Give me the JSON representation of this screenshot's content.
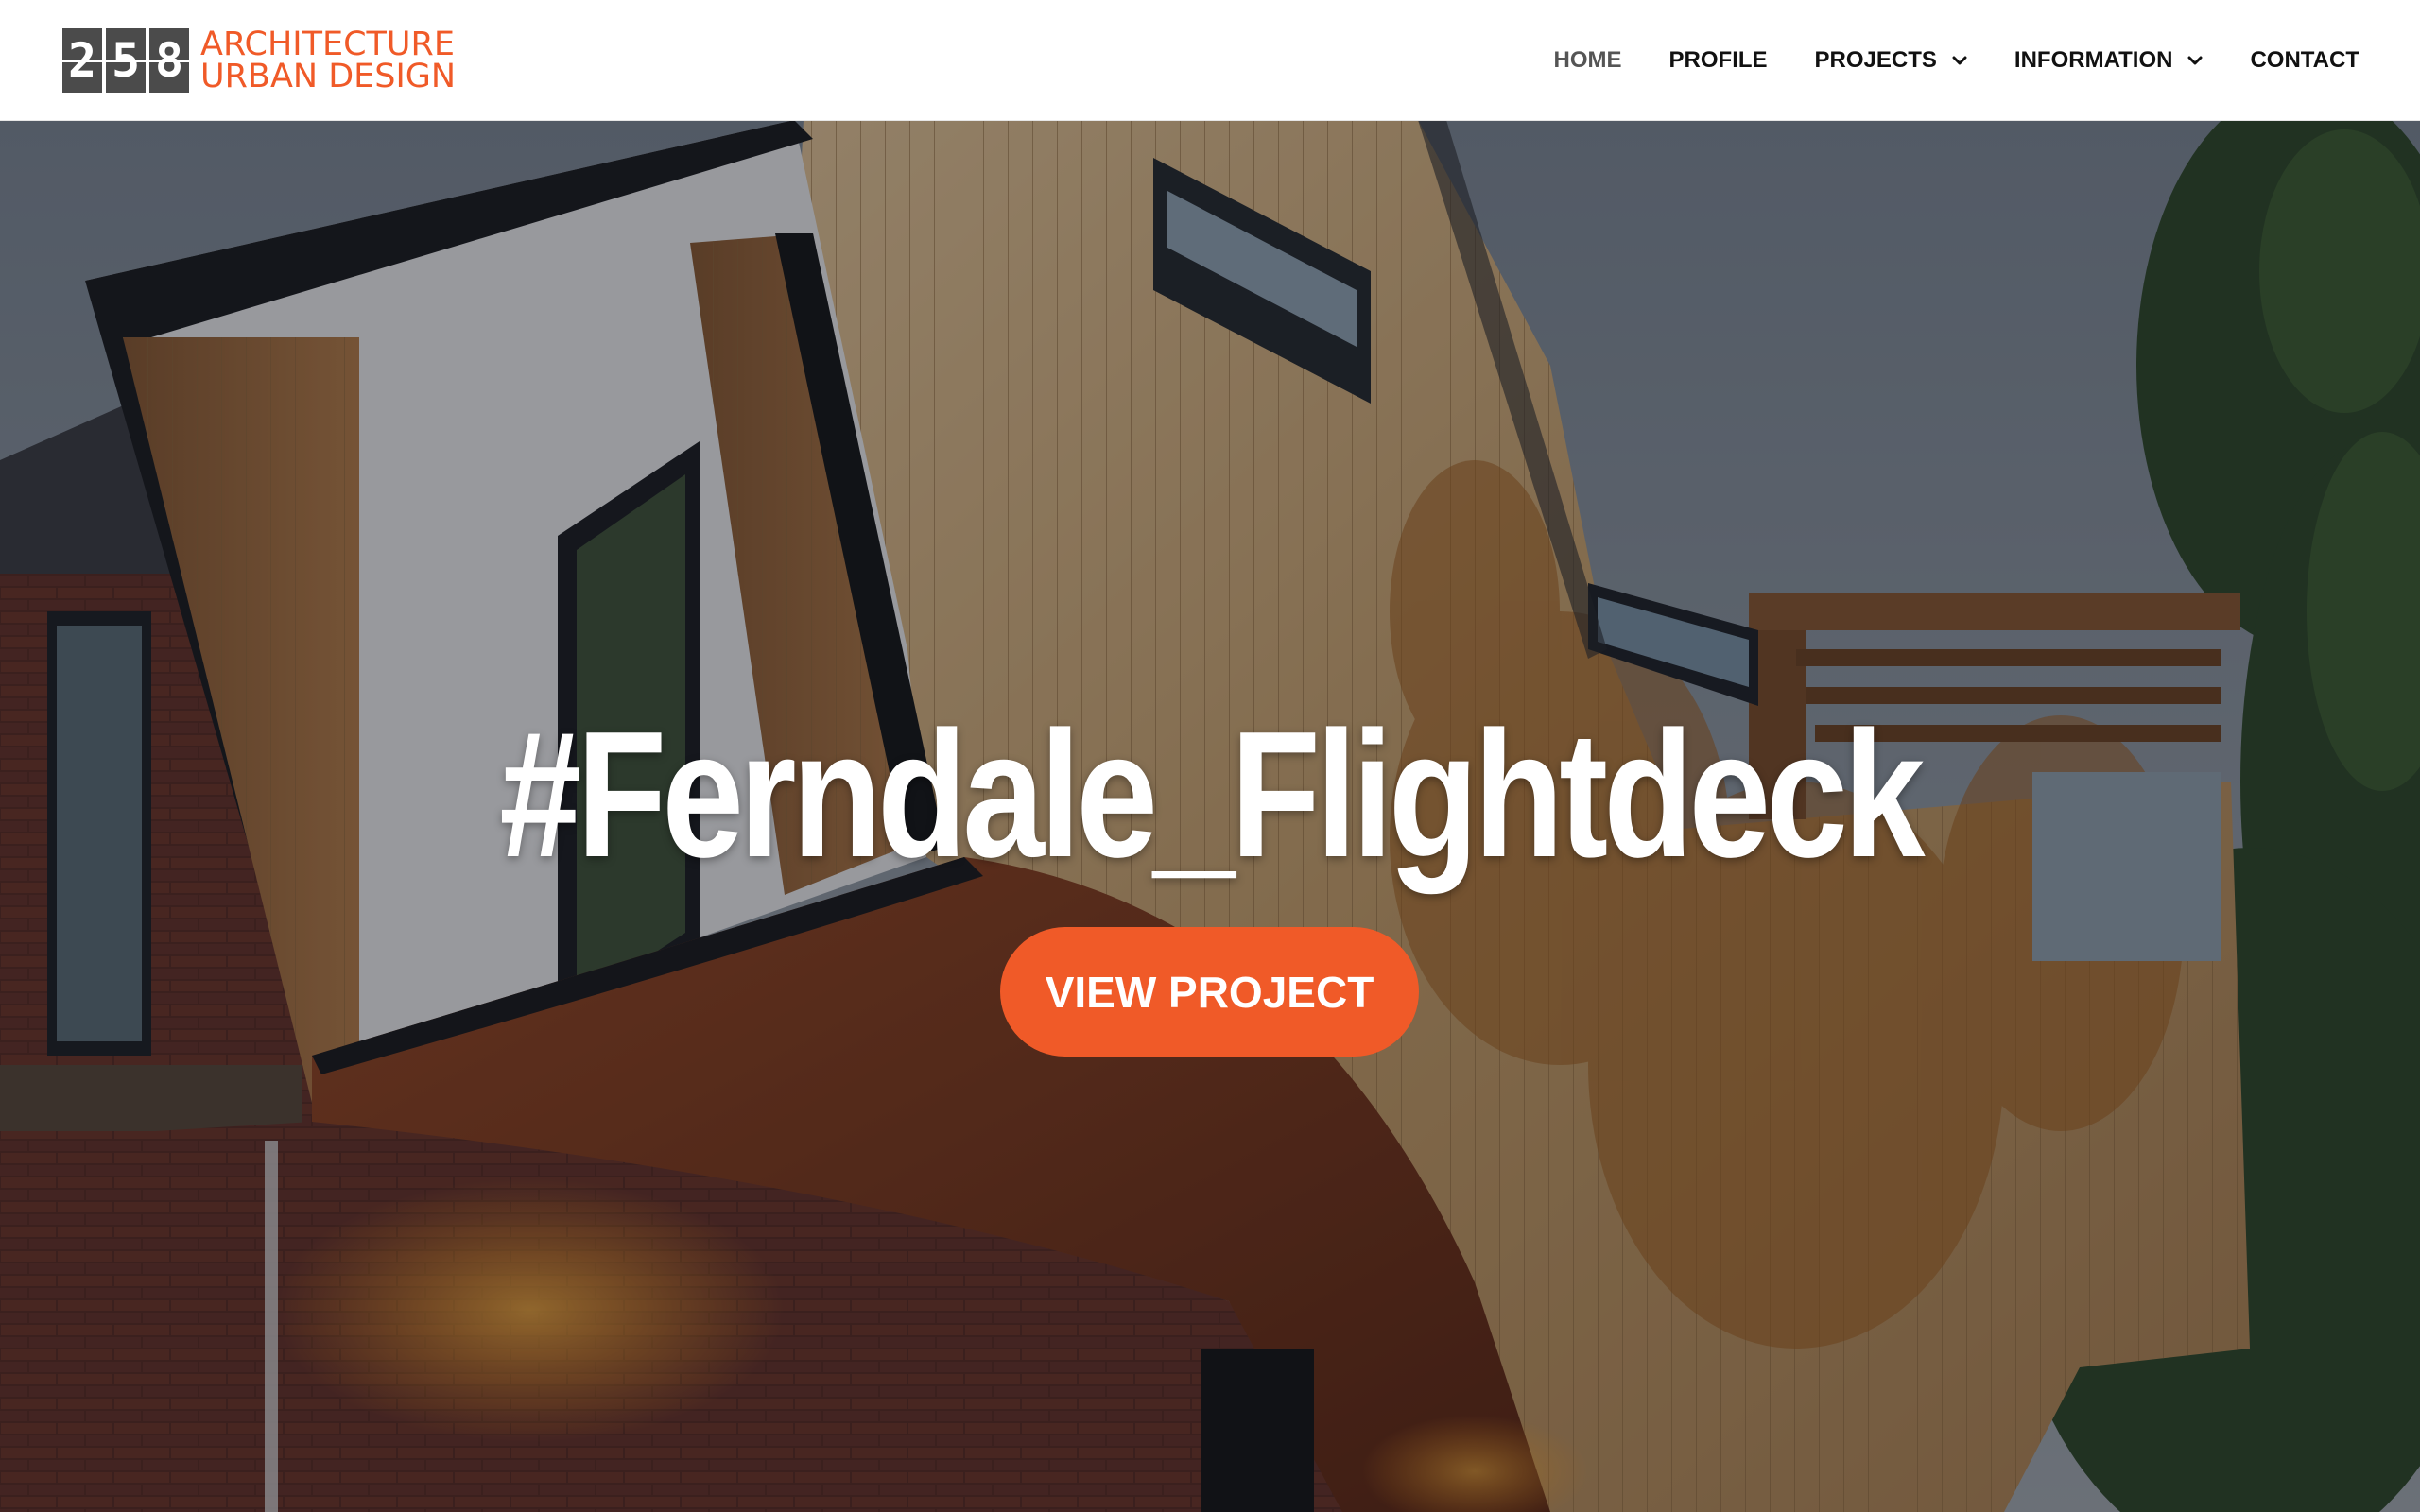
{
  "brand": {
    "digits": [
      "2",
      "5",
      "8"
    ],
    "line1": "ARCHITECTURE",
    "line2": "URBAN DESIGN",
    "accent_color": "#f05a28"
  },
  "nav": {
    "items": [
      {
        "label": "HOME",
        "active": true,
        "has_dropdown": false
      },
      {
        "label": "PROFILE",
        "active": false,
        "has_dropdown": false
      },
      {
        "label": "PROJECTS",
        "active": false,
        "has_dropdown": true
      },
      {
        "label": "INFORMATION",
        "active": false,
        "has_dropdown": true
      },
      {
        "label": "CONTACT",
        "active": false,
        "has_dropdown": false
      }
    ],
    "dropdown_icon": "chevron-down-icon"
  },
  "hero": {
    "title": "#Ferndale_Flightdeck",
    "cta_label": "VIEW PROJECT",
    "cta_color": "#f05a28",
    "image": "timber-clad house with cantilevered wings and brick base"
  }
}
